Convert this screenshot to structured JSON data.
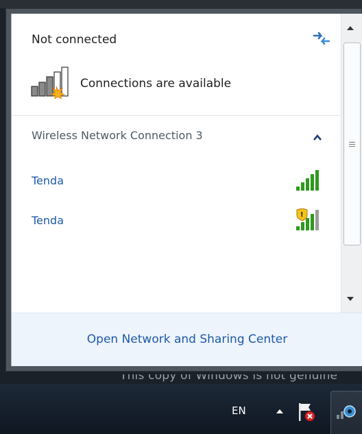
{
  "popup": {
    "status_title": "Not connected",
    "connections_text": "Connections are available",
    "section_title": "Wireless Network Connection 3",
    "networks": [
      {
        "name": "Tenda",
        "icon": "wifi-signal-icon",
        "secured": false
      },
      {
        "name": "Tenda",
        "icon": "wifi-signal-secured-icon",
        "secured": true
      }
    ],
    "footer_link": "Open Network and Sharing Center"
  },
  "watermark": "This copy of Windows is not genuine",
  "taskbar": {
    "language": "EN"
  },
  "colors": {
    "link": "#1c5aa8",
    "signal_green": "#2e9a1e",
    "taskbar": "#1d2938"
  }
}
